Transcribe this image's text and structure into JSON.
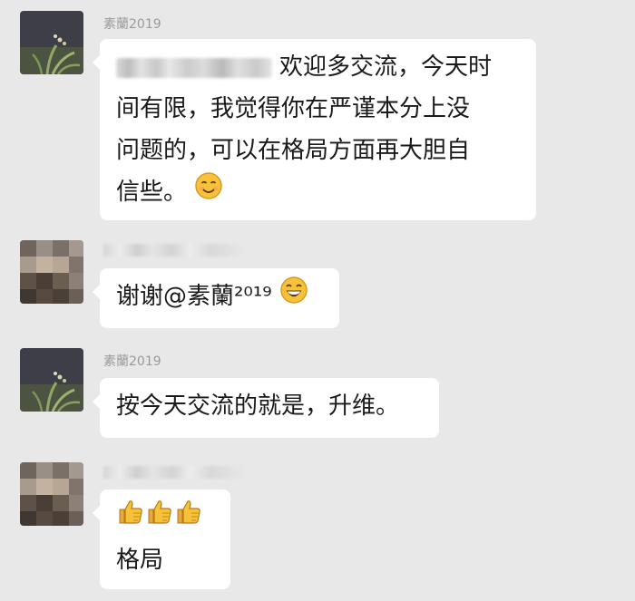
{
  "messages": [
    {
      "sender": "素蘭2019",
      "text_lines": [
        "欢迎多交流，今天时",
        "间有限，我觉得你在严谨本分上没",
        "问题的，可以在格局方面再大胆自",
        "信些。"
      ],
      "emoji": "smiling-face"
    },
    {
      "sender": "",
      "text": "谢谢@素蘭²⁰¹⁹",
      "emoji": "grinning-face"
    },
    {
      "sender": "素蘭2019",
      "text": "按今天交流的就是，升维。"
    },
    {
      "sender": "",
      "emojis": [
        "thumbs-up",
        "thumbs-up",
        "thumbs-up"
      ],
      "text": "格局"
    }
  ]
}
